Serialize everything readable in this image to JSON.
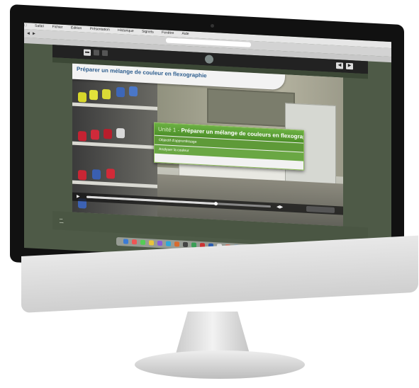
{
  "browser": {
    "menu": [
      "Safari",
      "Fichier",
      "Édition",
      "Présentation",
      "Historique",
      "Signets",
      "Fenêtre",
      "Aide"
    ],
    "url": "",
    "bookmarks": ""
  },
  "course": {
    "title": "Préparer un mélange de couleur en flexographie",
    "panel": {
      "unit_label": "Unité 1 - ",
      "unit_title": "Préparer un mélange de couleurs en flexographie",
      "items": [
        "Objectif d'apprentissage",
        "Analyser la couleur"
      ]
    },
    "player": {
      "progress": 0.7,
      "button_label": ""
    }
  },
  "icons": [
    "folder-icon",
    "gear-icon",
    "help-icon",
    "back-icon",
    "forward-icon",
    "play-icon",
    "volume-icon"
  ],
  "colors": {
    "accent_green": "#5aa033",
    "title_blue": "#2e5e8e",
    "app_background": "#4e5a47"
  }
}
